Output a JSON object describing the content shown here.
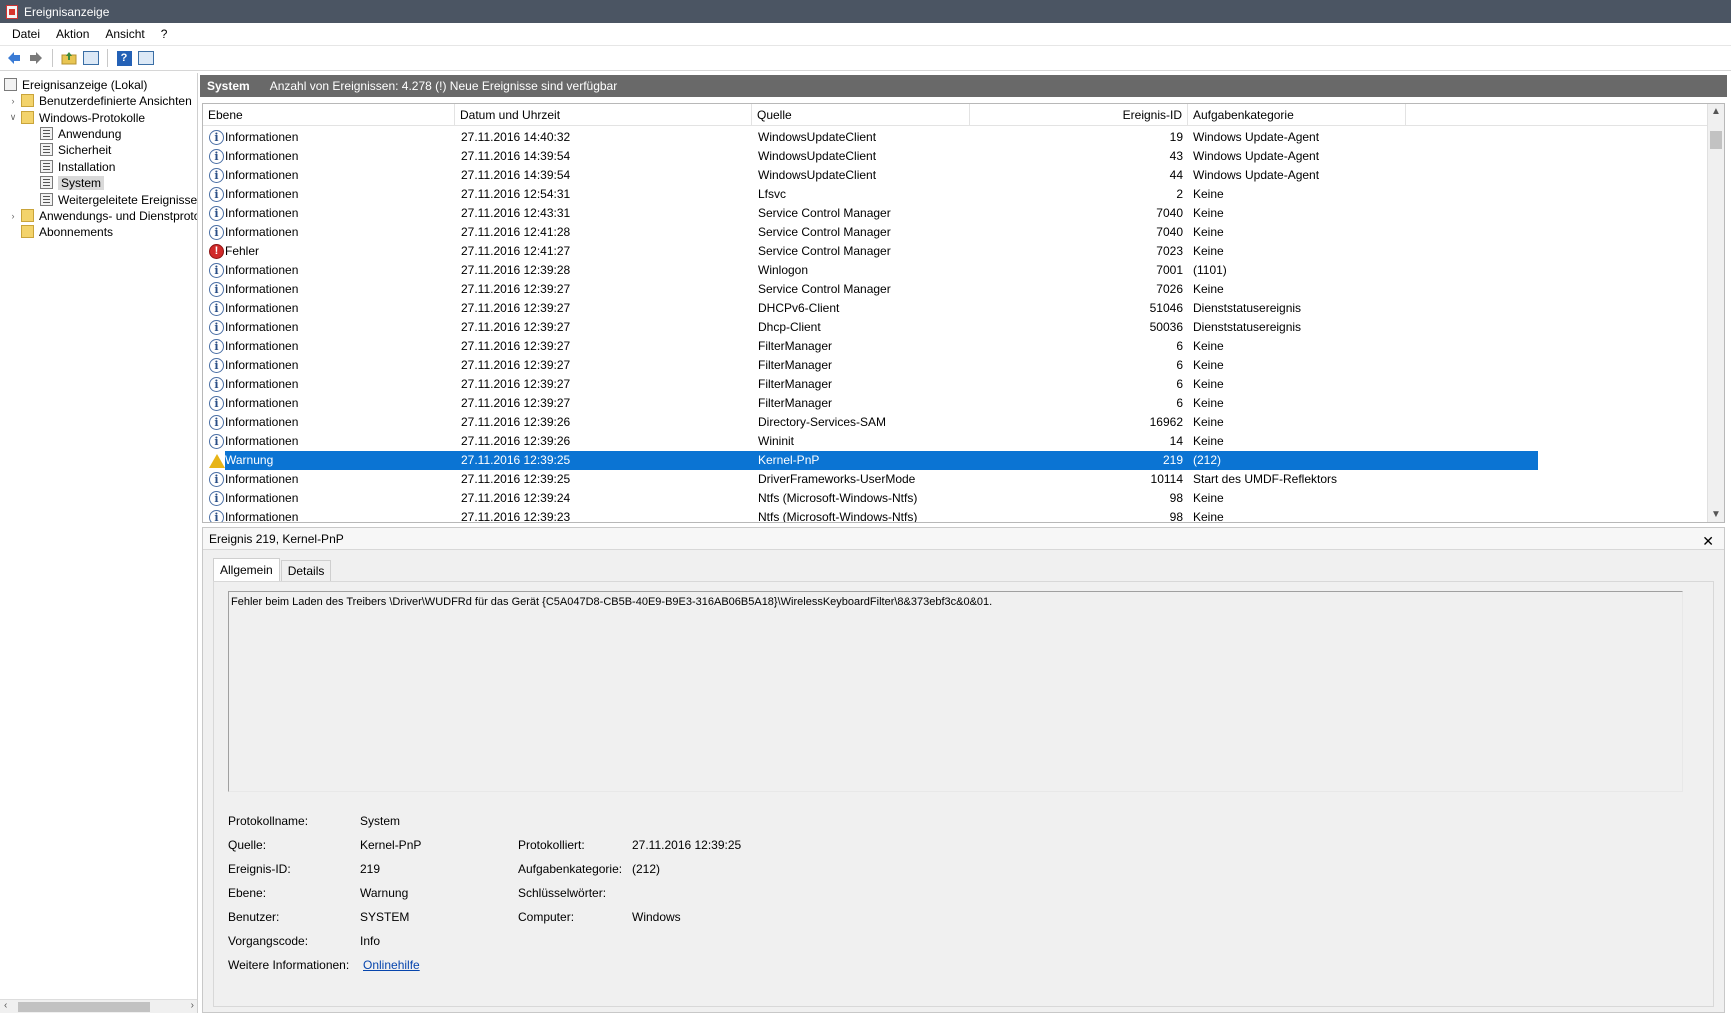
{
  "window": {
    "title": "Ereignisanzeige"
  },
  "menu": [
    "Datei",
    "Aktion",
    "Ansicht",
    "?"
  ],
  "tree": [
    {
      "label": "Ereignisanzeige (Lokal)",
      "expander": "",
      "level": 0,
      "kind": "root"
    },
    {
      "label": "Benutzerdefinierte Ansichten",
      "expander": ">",
      "level": 1,
      "kind": "folder"
    },
    {
      "label": "Windows-Protokolle",
      "expander": "v",
      "level": 1,
      "kind": "folder"
    },
    {
      "label": "Anwendung",
      "expander": "",
      "level": 2,
      "kind": "log"
    },
    {
      "label": "Sicherheit",
      "expander": "",
      "level": 2,
      "kind": "log"
    },
    {
      "label": "Installation",
      "expander": "",
      "level": 2,
      "kind": "log"
    },
    {
      "label": "System",
      "expander": "",
      "level": 2,
      "kind": "log",
      "selected": true
    },
    {
      "label": "Weitergeleitete Ereignisse",
      "expander": "",
      "level": 2,
      "kind": "log"
    },
    {
      "label": "Anwendungs- und Dienstprotokolle",
      "expander": ">",
      "level": 1,
      "kind": "folder"
    },
    {
      "label": "Abonnements",
      "expander": "",
      "level": 1,
      "kind": "folder"
    }
  ],
  "header": {
    "title": "System",
    "info": "Anzahl von Ereignissen: 4.278 (!) Neue Ereignisse sind verfügbar"
  },
  "columns": {
    "level": "Ebene",
    "date": "Datum und Uhrzeit",
    "source": "Quelle",
    "id": "Ereignis-ID",
    "category": "Aufgabenkategorie"
  },
  "events": [
    {
      "level": "Informationen",
      "type": "info",
      "date": "27.11.2016 14:40:32",
      "source": "WindowsUpdateClient",
      "id": "19",
      "category": "Windows Update-Agent"
    },
    {
      "level": "Informationen",
      "type": "info",
      "date": "27.11.2016 14:39:54",
      "source": "WindowsUpdateClient",
      "id": "43",
      "category": "Windows Update-Agent"
    },
    {
      "level": "Informationen",
      "type": "info",
      "date": "27.11.2016 14:39:54",
      "source": "WindowsUpdateClient",
      "id": "44",
      "category": "Windows Update-Agent"
    },
    {
      "level": "Informationen",
      "type": "info",
      "date": "27.11.2016 12:54:31",
      "source": "Lfsvc",
      "id": "2",
      "category": "Keine"
    },
    {
      "level": "Informationen",
      "type": "info",
      "date": "27.11.2016 12:43:31",
      "source": "Service Control Manager",
      "id": "7040",
      "category": "Keine"
    },
    {
      "level": "Informationen",
      "type": "info",
      "date": "27.11.2016 12:41:28",
      "source": "Service Control Manager",
      "id": "7040",
      "category": "Keine"
    },
    {
      "level": "Fehler",
      "type": "error",
      "date": "27.11.2016 12:41:27",
      "source": "Service Control Manager",
      "id": "7023",
      "category": "Keine"
    },
    {
      "level": "Informationen",
      "type": "info",
      "date": "27.11.2016 12:39:28",
      "source": "Winlogon",
      "id": "7001",
      "category": "(1101)"
    },
    {
      "level": "Informationen",
      "type": "info",
      "date": "27.11.2016 12:39:27",
      "source": "Service Control Manager",
      "id": "7026",
      "category": "Keine"
    },
    {
      "level": "Informationen",
      "type": "info",
      "date": "27.11.2016 12:39:27",
      "source": "DHCPv6-Client",
      "id": "51046",
      "category": "Dienststatusereignis"
    },
    {
      "level": "Informationen",
      "type": "info",
      "date": "27.11.2016 12:39:27",
      "source": "Dhcp-Client",
      "id": "50036",
      "category": "Dienststatusereignis"
    },
    {
      "level": "Informationen",
      "type": "info",
      "date": "27.11.2016 12:39:27",
      "source": "FilterManager",
      "id": "6",
      "category": "Keine"
    },
    {
      "level": "Informationen",
      "type": "info",
      "date": "27.11.2016 12:39:27",
      "source": "FilterManager",
      "id": "6",
      "category": "Keine"
    },
    {
      "level": "Informationen",
      "type": "info",
      "date": "27.11.2016 12:39:27",
      "source": "FilterManager",
      "id": "6",
      "category": "Keine"
    },
    {
      "level": "Informationen",
      "type": "info",
      "date": "27.11.2016 12:39:27",
      "source": "FilterManager",
      "id": "6",
      "category": "Keine"
    },
    {
      "level": "Informationen",
      "type": "info",
      "date": "27.11.2016 12:39:26",
      "source": "Directory-Services-SAM",
      "id": "16962",
      "category": "Keine"
    },
    {
      "level": "Informationen",
      "type": "info",
      "date": "27.11.2016 12:39:26",
      "source": "Wininit",
      "id": "14",
      "category": "Keine"
    },
    {
      "level": "Warnung",
      "type": "warning",
      "date": "27.11.2016 12:39:25",
      "source": "Kernel-PnP",
      "id": "219",
      "category": "(212)",
      "selected": true
    },
    {
      "level": "Informationen",
      "type": "info",
      "date": "27.11.2016 12:39:25",
      "source": "DriverFrameworks-UserMode",
      "id": "10114",
      "category": "Start des UMDF-Reflektors"
    },
    {
      "level": "Informationen",
      "type": "info",
      "date": "27.11.2016 12:39:24",
      "source": "Ntfs (Microsoft-Windows-Ntfs)",
      "id": "98",
      "category": "Keine"
    },
    {
      "level": "Informationen",
      "type": "info",
      "date": "27.11.2016 12:39:23",
      "source": "Ntfs (Microsoft-Windows-Ntfs)",
      "id": "98",
      "category": "Keine"
    }
  ],
  "detail": {
    "title": "Ereignis 219, Kernel-PnP",
    "close": "✕",
    "tabs": {
      "general": "Allgemein",
      "details": "Details"
    },
    "message": "Fehler beim Laden des Treibers \\Driver\\WUDFRd für das Gerät {C5A047D8-CB5B-40E9-B9E3-316AB06B5A18}\\WirelessKeyboardFilter\\8&373ebf3c&0&01.",
    "labels": {
      "logname": "Protokollname:",
      "source": "Quelle:",
      "eventid": "Ereignis-ID:",
      "level": "Ebene:",
      "user": "Benutzer:",
      "opcode": "Vorgangscode:",
      "moreinfo": "Weitere Informationen:",
      "logged": "Protokolliert:",
      "taskcat": "Aufgabenkategorie:",
      "keywords": "Schlüsselwörter:",
      "computer": "Computer:"
    },
    "values": {
      "logname": "System",
      "source": "Kernel-PnP",
      "eventid": "219",
      "level": "Warnung",
      "user": "SYSTEM",
      "opcode": "Info",
      "moreinfo": "Onlinehilfe",
      "logged": "27.11.2016 12:39:25",
      "taskcat": "(212)",
      "keywords": "",
      "computer": "Windows"
    }
  },
  "colors": {
    "selection": "#0b74d3",
    "header_bar": "#696969",
    "titlebar": "#4b5563"
  }
}
